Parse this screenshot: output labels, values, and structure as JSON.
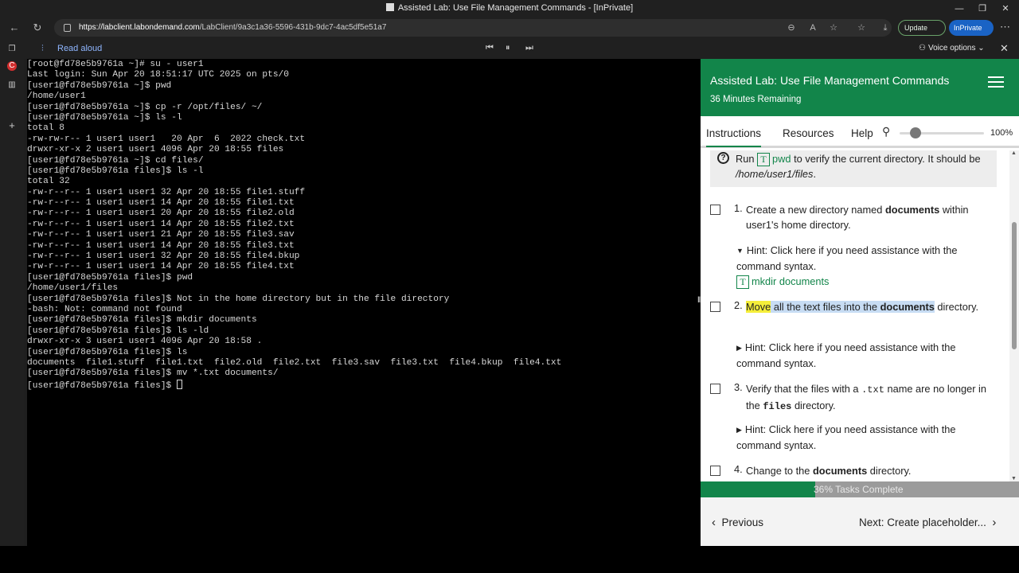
{
  "window": {
    "title": "Assisted Lab: Use File Management Commands - [InPrivate]",
    "controls": [
      "—",
      "❐",
      "✕"
    ]
  },
  "browser": {
    "url_host": "https://labclient.labondemand.com",
    "url_path": "/LabClient/9a3c1a36-5596-431b-9dc7-4ac5df5e51a7",
    "update_label": "Update",
    "inprivate_label": "InPrivate",
    "read_aloud_label": "Read aloud",
    "voice_options_label": "Voice options"
  },
  "terminal": {
    "lines": [
      "[root@fd78e5b9761a ~]# su - user1",
      "Last login: Sun Apr 20 18:51:17 UTC 2025 on pts/0",
      "[user1@fd78e5b9761a ~]$ pwd",
      "/home/user1",
      "[user1@fd78e5b9761a ~]$ cp -r /opt/files/ ~/",
      "[user1@fd78e5b9761a ~]$ ls -l",
      "total 8",
      "-rw-rw-r-- 1 user1 user1   20 Apr  6  2022 check.txt",
      "drwxr-xr-x 2 user1 user1 4096 Apr 20 18:55 files",
      "[user1@fd78e5b9761a ~]$ cd files/",
      "[user1@fd78e5b9761a files]$ ls -l",
      "total 32",
      "-rw-r--r-- 1 user1 user1 32 Apr 20 18:55 file1.stuff",
      "-rw-r--r-- 1 user1 user1 14 Apr 20 18:55 file1.txt",
      "-rw-r--r-- 1 user1 user1 20 Apr 20 18:55 file2.old",
      "-rw-r--r-- 1 user1 user1 14 Apr 20 18:55 file2.txt",
      "-rw-r--r-- 1 user1 user1 21 Apr 20 18:55 file3.sav",
      "-rw-r--r-- 1 user1 user1 14 Apr 20 18:55 file3.txt",
      "-rw-r--r-- 1 user1 user1 32 Apr 20 18:55 file4.bkup",
      "-rw-r--r-- 1 user1 user1 14 Apr 20 18:55 file4.txt",
      "[user1@fd78e5b9761a files]$ pwd",
      "/home/user1/files",
      "[user1@fd78e5b9761a files]$ Not in the home directory but in the file directory",
      "-bash: Not: command not found",
      "[user1@fd78e5b9761a files]$ mkdir documents",
      "[user1@fd78e5b9761a files]$ ls -ld",
      "drwxr-xr-x 3 user1 user1 4096 Apr 20 18:58 .",
      "[user1@fd78e5b9761a files]$ ls",
      "documents  file1.stuff  file1.txt  file2.old  file2.txt  file3.sav  file3.txt  file4.bkup  file4.txt",
      "[user1@fd78e5b9761a files]$ mv *.txt documents/",
      "[user1@fd78e5b9761a files]$ "
    ]
  },
  "panel": {
    "title": "Assisted Lab: Use File Management Commands",
    "time_remaining": "36 Minutes Remaining",
    "tabs": [
      "Instructions",
      "Resources",
      "Help"
    ],
    "zoom": "100%",
    "zoom_fraction": 0.12,
    "note": {
      "run": "Run",
      "cmd": "pwd",
      "mid": "to verify the current directory. It should be",
      "path": "/home/user1/files",
      "end": "."
    },
    "tasks": [
      {
        "num": "1.",
        "pre": "Create a new directory named",
        "bold": "documents",
        "post": "within user1's home directory."
      },
      {
        "num": "2.",
        "hl_word": "Move",
        "pre": " all the text files into the",
        "bold": "documents",
        "post": "directory."
      },
      {
        "num": "3.",
        "pre": "Verify that the files with a",
        "code1": ".txt",
        "mid": "name are no longer in the",
        "code2": "files",
        "post": "directory."
      },
      {
        "num": "4.",
        "pre": "Change to the",
        "bold": "documents",
        "post": "directory."
      }
    ],
    "hint_text": "Hint: Click here if you need assistance with the command syntax.",
    "hint1_cmd": "mkdir documents",
    "code_tag": "T",
    "progress_label": "36% Tasks Complete",
    "progress_fraction": 0.36,
    "prev_label": "Previous",
    "next_label": "Next: Create placeholder..."
  }
}
